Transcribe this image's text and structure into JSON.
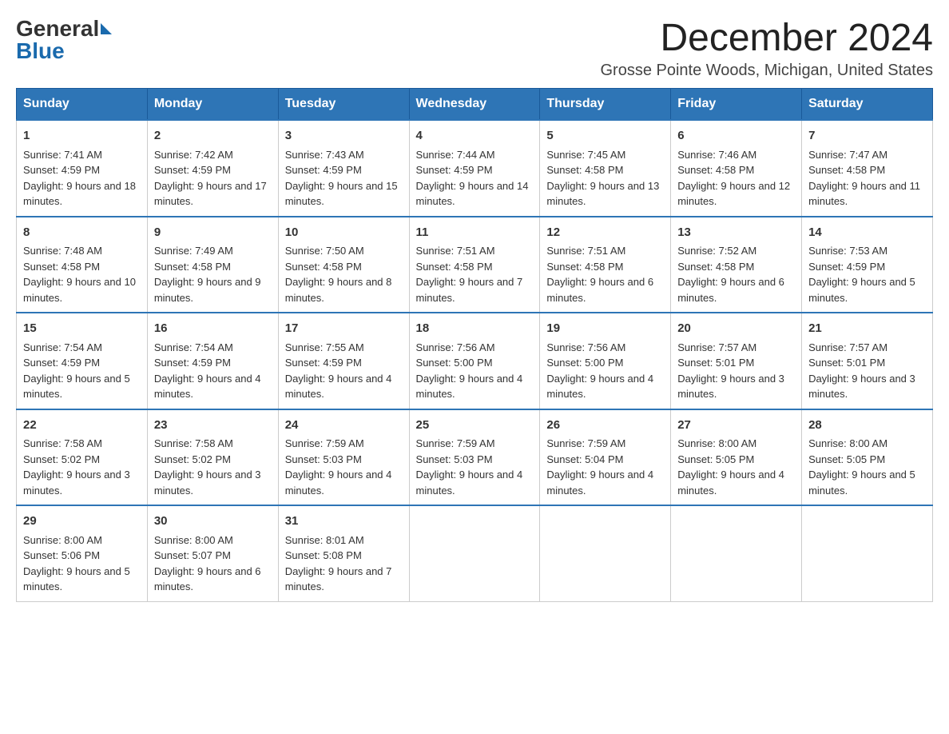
{
  "header": {
    "logo": {
      "general": "General",
      "blue": "Blue"
    },
    "title": "December 2024",
    "location": "Grosse Pointe Woods, Michigan, United States"
  },
  "calendar": {
    "days_of_week": [
      "Sunday",
      "Monday",
      "Tuesday",
      "Wednesday",
      "Thursday",
      "Friday",
      "Saturday"
    ],
    "weeks": [
      [
        {
          "day": "1",
          "sunrise": "7:41 AM",
          "sunset": "4:59 PM",
          "daylight": "9 hours and 18 minutes."
        },
        {
          "day": "2",
          "sunrise": "7:42 AM",
          "sunset": "4:59 PM",
          "daylight": "9 hours and 17 minutes."
        },
        {
          "day": "3",
          "sunrise": "7:43 AM",
          "sunset": "4:59 PM",
          "daylight": "9 hours and 15 minutes."
        },
        {
          "day": "4",
          "sunrise": "7:44 AM",
          "sunset": "4:59 PM",
          "daylight": "9 hours and 14 minutes."
        },
        {
          "day": "5",
          "sunrise": "7:45 AM",
          "sunset": "4:58 PM",
          "daylight": "9 hours and 13 minutes."
        },
        {
          "day": "6",
          "sunrise": "7:46 AM",
          "sunset": "4:58 PM",
          "daylight": "9 hours and 12 minutes."
        },
        {
          "day": "7",
          "sunrise": "7:47 AM",
          "sunset": "4:58 PM",
          "daylight": "9 hours and 11 minutes."
        }
      ],
      [
        {
          "day": "8",
          "sunrise": "7:48 AM",
          "sunset": "4:58 PM",
          "daylight": "9 hours and 10 minutes."
        },
        {
          "day": "9",
          "sunrise": "7:49 AM",
          "sunset": "4:58 PM",
          "daylight": "9 hours and 9 minutes."
        },
        {
          "day": "10",
          "sunrise": "7:50 AM",
          "sunset": "4:58 PM",
          "daylight": "9 hours and 8 minutes."
        },
        {
          "day": "11",
          "sunrise": "7:51 AM",
          "sunset": "4:58 PM",
          "daylight": "9 hours and 7 minutes."
        },
        {
          "day": "12",
          "sunrise": "7:51 AM",
          "sunset": "4:58 PM",
          "daylight": "9 hours and 6 minutes."
        },
        {
          "day": "13",
          "sunrise": "7:52 AM",
          "sunset": "4:58 PM",
          "daylight": "9 hours and 6 minutes."
        },
        {
          "day": "14",
          "sunrise": "7:53 AM",
          "sunset": "4:59 PM",
          "daylight": "9 hours and 5 minutes."
        }
      ],
      [
        {
          "day": "15",
          "sunrise": "7:54 AM",
          "sunset": "4:59 PM",
          "daylight": "9 hours and 5 minutes."
        },
        {
          "day": "16",
          "sunrise": "7:54 AM",
          "sunset": "4:59 PM",
          "daylight": "9 hours and 4 minutes."
        },
        {
          "day": "17",
          "sunrise": "7:55 AM",
          "sunset": "4:59 PM",
          "daylight": "9 hours and 4 minutes."
        },
        {
          "day": "18",
          "sunrise": "7:56 AM",
          "sunset": "5:00 PM",
          "daylight": "9 hours and 4 minutes."
        },
        {
          "day": "19",
          "sunrise": "7:56 AM",
          "sunset": "5:00 PM",
          "daylight": "9 hours and 4 minutes."
        },
        {
          "day": "20",
          "sunrise": "7:57 AM",
          "sunset": "5:01 PM",
          "daylight": "9 hours and 3 minutes."
        },
        {
          "day": "21",
          "sunrise": "7:57 AM",
          "sunset": "5:01 PM",
          "daylight": "9 hours and 3 minutes."
        }
      ],
      [
        {
          "day": "22",
          "sunrise": "7:58 AM",
          "sunset": "5:02 PM",
          "daylight": "9 hours and 3 minutes."
        },
        {
          "day": "23",
          "sunrise": "7:58 AM",
          "sunset": "5:02 PM",
          "daylight": "9 hours and 3 minutes."
        },
        {
          "day": "24",
          "sunrise": "7:59 AM",
          "sunset": "5:03 PM",
          "daylight": "9 hours and 4 minutes."
        },
        {
          "day": "25",
          "sunrise": "7:59 AM",
          "sunset": "5:03 PM",
          "daylight": "9 hours and 4 minutes."
        },
        {
          "day": "26",
          "sunrise": "7:59 AM",
          "sunset": "5:04 PM",
          "daylight": "9 hours and 4 minutes."
        },
        {
          "day": "27",
          "sunrise": "8:00 AM",
          "sunset": "5:05 PM",
          "daylight": "9 hours and 4 minutes."
        },
        {
          "day": "28",
          "sunrise": "8:00 AM",
          "sunset": "5:05 PM",
          "daylight": "9 hours and 5 minutes."
        }
      ],
      [
        {
          "day": "29",
          "sunrise": "8:00 AM",
          "sunset": "5:06 PM",
          "daylight": "9 hours and 5 minutes."
        },
        {
          "day": "30",
          "sunrise": "8:00 AM",
          "sunset": "5:07 PM",
          "daylight": "9 hours and 6 minutes."
        },
        {
          "day": "31",
          "sunrise": "8:01 AM",
          "sunset": "5:08 PM",
          "daylight": "9 hours and 7 minutes."
        },
        null,
        null,
        null,
        null
      ]
    ]
  }
}
